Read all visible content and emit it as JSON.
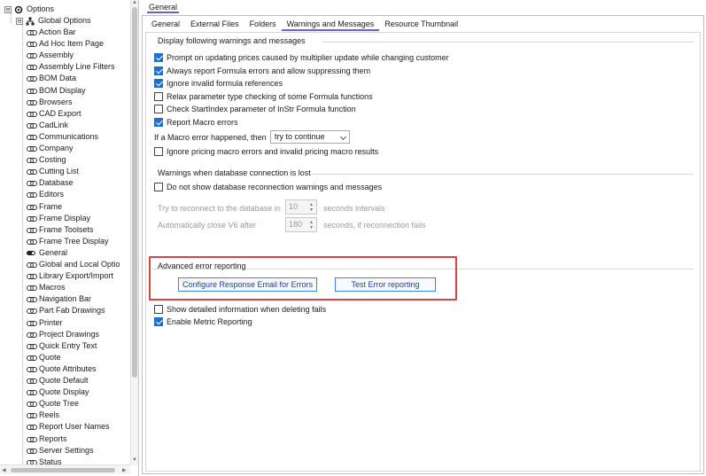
{
  "tree": {
    "root_expander": "⊟",
    "root_label": "Options",
    "group_expander": "⊟",
    "group_label": "Global Options",
    "items": [
      {
        "label": "Action Bar",
        "icon": "link-icon"
      },
      {
        "label": "Ad Hoc Item Page",
        "icon": "link-icon"
      },
      {
        "label": "Assembly",
        "icon": "link-icon"
      },
      {
        "label": "Assembly Line Filters",
        "icon": "link-icon"
      },
      {
        "label": "BOM Data",
        "icon": "link-icon"
      },
      {
        "label": "BOM Display",
        "icon": "link-icon"
      },
      {
        "label": "Browsers",
        "icon": "link-icon"
      },
      {
        "label": "CAD Export",
        "icon": "link-icon"
      },
      {
        "label": "CadLink",
        "icon": "link-icon"
      },
      {
        "label": "Communications",
        "icon": "link-icon"
      },
      {
        "label": "Company",
        "icon": "link-icon"
      },
      {
        "label": "Costing",
        "icon": "link-icon"
      },
      {
        "label": "Cutting List",
        "icon": "link-icon"
      },
      {
        "label": "Database",
        "icon": "link-icon"
      },
      {
        "label": "Editors",
        "icon": "link-icon"
      },
      {
        "label": "Frame",
        "icon": "link-icon"
      },
      {
        "label": "Frame Display",
        "icon": "link-icon"
      },
      {
        "label": "Frame Toolsets",
        "icon": "link-icon"
      },
      {
        "label": "Frame Tree Display",
        "icon": "link-icon"
      },
      {
        "label": "General",
        "icon": "toggle-icon"
      },
      {
        "label": "Global and Local Optio",
        "icon": "link-icon"
      },
      {
        "label": "Library Export/Import",
        "icon": "link-icon"
      },
      {
        "label": "Macros",
        "icon": "link-icon"
      },
      {
        "label": "Navigation Bar",
        "icon": "link-icon"
      },
      {
        "label": "Part Fab Drawings",
        "icon": "link-icon"
      },
      {
        "label": "Printer",
        "icon": "link-icon"
      },
      {
        "label": "Project Drawings",
        "icon": "link-icon"
      },
      {
        "label": "Quick Entry Text",
        "icon": "link-icon"
      },
      {
        "label": "Quote",
        "icon": "link-icon"
      },
      {
        "label": "Quote Attributes",
        "icon": "link-icon"
      },
      {
        "label": "Quote Default",
        "icon": "link-icon"
      },
      {
        "label": "Quote Display",
        "icon": "link-icon"
      },
      {
        "label": "Quote Tree",
        "icon": "link-icon"
      },
      {
        "label": "Reels",
        "icon": "link-icon"
      },
      {
        "label": "Report User Names",
        "icon": "link-icon"
      },
      {
        "label": "Reports",
        "icon": "link-icon"
      },
      {
        "label": "Server Settings",
        "icon": "link-icon"
      },
      {
        "label": "Status",
        "icon": "link-icon"
      }
    ]
  },
  "top_tab": "General",
  "sub_tabs": [
    "General",
    "External Files",
    "Folders",
    "Warnings and Messages",
    "Resource Thumbnail"
  ],
  "active_sub_tab": "Warnings and Messages",
  "display_group": {
    "title": "Display following warnings and messages",
    "checkboxes": [
      {
        "label": "Prompt on updating prices caused by multiplier update while changing customer",
        "checked": true
      },
      {
        "label": "Always report Formula errors and allow suppressing them",
        "checked": true
      },
      {
        "label": "Ignore invalid formula references",
        "checked": true
      },
      {
        "label": "Relax parameter type checking of some Formula functions",
        "checked": false
      },
      {
        "label": "Check StartIndex parameter of InStr Formula function",
        "checked": false
      },
      {
        "label": "Report Macro errors",
        "checked": true
      }
    ],
    "macro_error_label": "If a Macro error happened, then",
    "macro_error_value": "try to continue",
    "ignore_pricing": {
      "label": "Ignore pricing macro errors and invalid pricing macro results",
      "checked": false
    }
  },
  "db_group": {
    "title": "Warnings when database connection is lost",
    "no_show": {
      "label": "Do not show database reconnection warnings and messages",
      "checked": false
    },
    "reconnect_label": "Try to reconnect to the database in",
    "reconnect_value": "10",
    "reconnect_unit": "seconds intervals",
    "autoclose_label": "Automatically close V6 after",
    "autoclose_value": "180",
    "autoclose_unit": "seconds, if reconnection fails"
  },
  "advanced_group": {
    "title": "Advanced error reporting",
    "configure_button": "Configure Response Email for Errors",
    "test_button": "Test Error reporting"
  },
  "bottom_checkboxes": [
    {
      "label": "Show detailed information when deleting fails",
      "checked": false
    },
    {
      "label": "Enable Metric Reporting",
      "checked": true
    }
  ],
  "colors": {
    "accent": "#6264d8",
    "checkbox": "#1f6fd1",
    "highlight": "#d64545",
    "button_border": "#3b82f6"
  }
}
